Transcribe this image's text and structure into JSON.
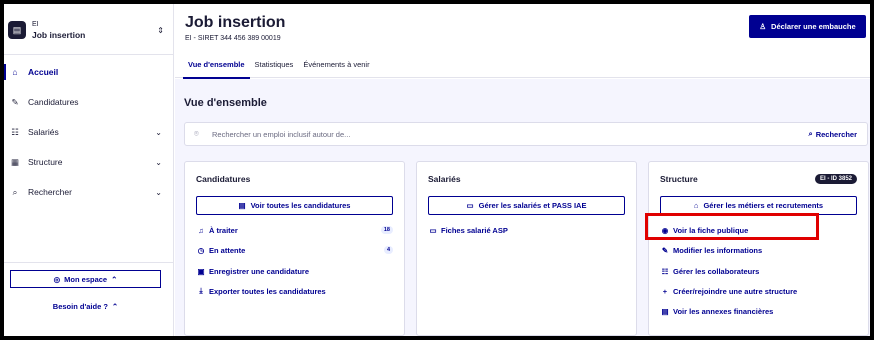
{
  "sidebar": {
    "org_kind": "EI",
    "org_name": "Job insertion",
    "items": [
      {
        "label": "Accueil"
      },
      {
        "label": "Candidatures"
      },
      {
        "label": "Salariés"
      },
      {
        "label": "Structure"
      },
      {
        "label": "Rechercher"
      }
    ],
    "mon_espace": "Mon espace",
    "besoin_aide": "Besoin d'aide ?"
  },
  "header": {
    "title": "Job insertion",
    "siret": "EI - SIRET 344 456 389 00019",
    "declare_button": "Déclarer une embauche",
    "tabs": [
      {
        "label": "Vue d'ensemble"
      },
      {
        "label": "Statistiques"
      },
      {
        "label": "Événements à venir"
      }
    ]
  },
  "main": {
    "section_title": "Vue d'ensemble",
    "search_placeholder": "Rechercher un emploi inclusif autour de...",
    "search_button": "Rechercher",
    "cards": {
      "candidatures": {
        "title": "Candidatures",
        "button": "Voir toutes les candidatures",
        "links": [
          {
            "label": "À traiter",
            "count": "18",
            "icon": "bell-icon"
          },
          {
            "label": "En attente",
            "count": "4",
            "icon": "clock-icon"
          },
          {
            "label": "Enregistrer une candidature",
            "icon": "form-icon"
          },
          {
            "label": "Exporter toutes les candidatures",
            "icon": "download-icon"
          }
        ]
      },
      "salaries": {
        "title": "Salariés",
        "button": "Gérer les salariés et PASS IAE",
        "links": [
          {
            "label": "Fiches salarié ASP",
            "icon": "id-card-icon"
          }
        ]
      },
      "structure": {
        "title": "Structure",
        "badge": "EI - ID 3852",
        "button": "Gérer les métiers et recrutements",
        "links": [
          {
            "label": "Voir la fiche publique",
            "icon": "eye-icon"
          },
          {
            "label": "Modifier les informations",
            "icon": "pencil-icon"
          },
          {
            "label": "Gérer les collaborateurs",
            "icon": "team-icon"
          },
          {
            "label": "Créer/rejoindre une autre structure",
            "icon": "plus-icon"
          },
          {
            "label": "Voir les annexes financières",
            "icon": "file-icon"
          }
        ]
      }
    }
  },
  "colors": {
    "accent": "#000091",
    "highlight": "#e00000",
    "dark": "#1b1b35"
  }
}
